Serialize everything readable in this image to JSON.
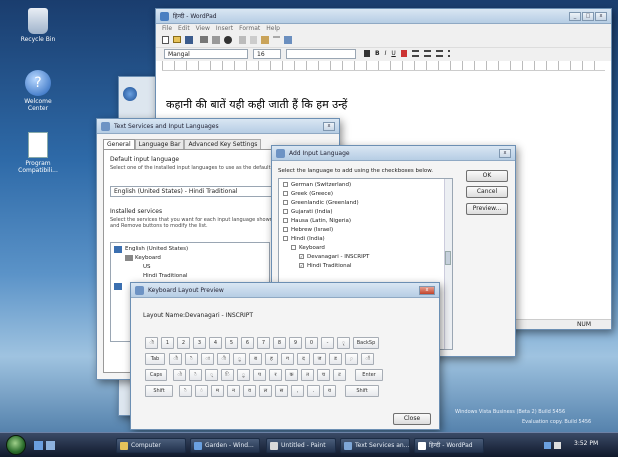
{
  "desktop": {
    "icons": [
      {
        "name": "recycle-bin",
        "label": "Recycle Bin"
      },
      {
        "name": "welcome-center",
        "label": "Welcome Center"
      },
      {
        "name": "program-compatibility",
        "label": "Program Compatibili..."
      }
    ],
    "watermark": [
      "Windows Vista Business (Beta 2) Build 5456",
      "Evaluation copy. Build 5456"
    ]
  },
  "wordpad": {
    "title": "हिन्दी - WordPad",
    "menu": [
      "File",
      "Edit",
      "View",
      "Insert",
      "Format",
      "Help"
    ],
    "font": "Mangal",
    "size": "16",
    "content": "कहानी की बातें यही कही जाती हैं कि हम उन्हें",
    "status_num": "NUM"
  },
  "text_services": {
    "title": "Text Services and Input Languages",
    "tabs": [
      "General",
      "Language Bar",
      "Advanced Key Settings"
    ],
    "default_heading": "Default input language",
    "default_desc": "Select one of the installed input languages to use as the default for all input fields.",
    "default_value": "English (United States) - Hindi Traditional",
    "installed_heading": "Installed services",
    "installed_desc": "Select the services that you want for each input language shown in the list. Use the Add and Remove buttons to modify the list.",
    "tree": [
      "English (United States)",
      "Keyboard",
      "US",
      "Hindi Traditional"
    ]
  },
  "add_language": {
    "title": "Add Input Language",
    "desc": "Select the language to add using the checkboxes below.",
    "items": [
      "German (Switzerland)",
      "Greek (Greece)",
      "Greenlandic (Greenland)",
      "Gujarati (India)",
      "Hausa (Latin, Nigeria)",
      "Hebrew (Israel)",
      "Hindi (India)",
      "Keyboard",
      "Devanagari - INSCRIPT",
      "Hindi Traditional"
    ],
    "checked": [
      false,
      false,
      false,
      false,
      false,
      false,
      false,
      false,
      true,
      true
    ],
    "ok": "OK",
    "cancel": "Cancel",
    "preview": "Preview..."
  },
  "keyboard_preview": {
    "title": "Keyboard Layout Preview",
    "layout_label": "Layout Name:",
    "layout_name": "Devanagari - INSCRIPT",
    "row1": [
      "ॊ",
      "1",
      "2",
      "3",
      "4",
      "5",
      "6",
      "7",
      "8",
      "9",
      "0",
      "-",
      "ृ"
    ],
    "backsp": "BackSp",
    "tab": "Tab",
    "row2": [
      "ौ",
      "ै",
      "ा",
      "ी",
      "ू",
      "ब",
      "ह",
      "ग",
      "द",
      "ज",
      "ड",
      "़",
      "ॉ"
    ],
    "caps": "Caps",
    "row3": [
      "ो",
      "े",
      "्",
      "ि",
      "ु",
      "प",
      "र",
      "क",
      "त",
      "च",
      "ट"
    ],
    "enter": "Enter",
    "shift": "Shift",
    "row4": [
      "ॆ",
      "ं",
      "म",
      "न",
      "व",
      "ल",
      "स",
      ",",
      ".",
      "य"
    ],
    "shift_r": "Shift",
    "close": "Close"
  },
  "taskbar": {
    "buttons": [
      "Computer",
      "Garden - Wind...",
      "Untitled - Paint",
      "Text Services an...",
      "हिन्दी - WordPad"
    ],
    "time": "3:52 PM"
  },
  "colors": {
    "accent": "#3b6fb0",
    "taskbar": "#1b2740",
    "close": "#c1442b"
  }
}
